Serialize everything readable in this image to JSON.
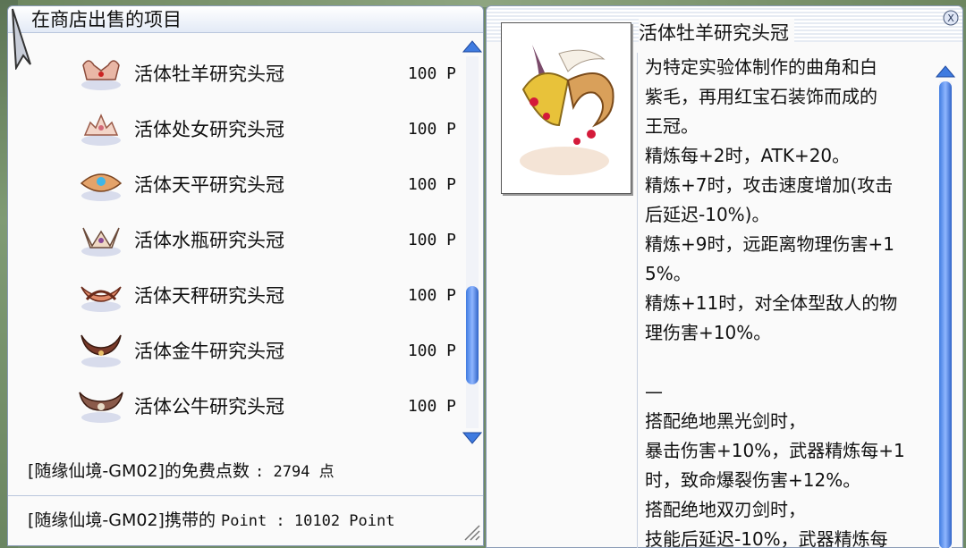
{
  "shop": {
    "title": "在商店出售的项目",
    "items": [
      {
        "name": "活体牡羊研究头冠",
        "price": "100 P",
        "icon": "aries-crown-icon"
      },
      {
        "name": "活体处女研究头冠",
        "price": "100 P",
        "icon": "virgo-crown-icon"
      },
      {
        "name": "活体天平研究头冠",
        "price": "100 P",
        "icon": "libra-crown-icon"
      },
      {
        "name": "活体水瓶研究头冠",
        "price": "100 P",
        "icon": "aquarius-crown-icon"
      },
      {
        "name": "活体天秤研究头冠",
        "price": "100 P",
        "icon": "libra2-crown-icon"
      },
      {
        "name": "活体金牛研究头冠",
        "price": "100 P",
        "icon": "taurus-crown-icon"
      },
      {
        "name": "活体公牛研究头冠",
        "price": "100 P",
        "icon": "bull-crown-icon"
      }
    ],
    "free_points_prefix": "[随缘仙境-GM02]的免费点数 ",
    "free_points_value": ": 2794 点",
    "carried_points_prefix": "[随缘仙境-GM02]携带的 ",
    "carried_points_value": "Point : 10102 Point",
    "scroll_position": 0.84
  },
  "item_detail": {
    "title": "活体牡羊研究头冠",
    "description_lines": [
      "为特定实验体制作的曲角和白",
      "紫毛，再用红宝石装饰而成的",
      "王冠。",
      "精炼每+2时，ATK+20。",
      "精炼+7时，攻击速度增加(攻击",
      "后延迟-10%)。",
      "精炼+9时，远距离物理伤害+1",
      "5%。",
      "精炼+11时，对全体型敌人的物",
      "理伤害+10%。",
      "",
      "—",
      "搭配绝地黑光剑时，",
      "暴击伤害+10%，武器精炼每+1",
      "时，致命爆裂伤害+12%。",
      "搭配绝地双刃剑时，",
      "技能后延迟-10%，武器精炼每"
    ],
    "close_label": "X"
  },
  "colors": {
    "scrollbar_blue": "#3f7be0",
    "window_border": "#8a9bb6",
    "background": "#fafafa"
  }
}
